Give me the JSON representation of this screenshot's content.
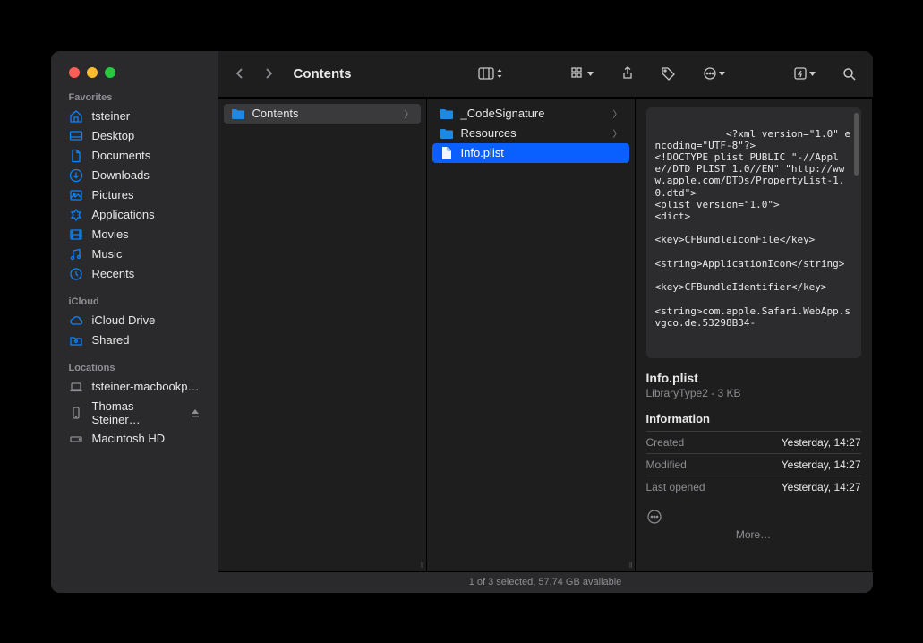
{
  "window": {
    "title": "Contents"
  },
  "sidebar": {
    "sections": [
      {
        "heading": "Favorites",
        "items": [
          {
            "label": "tsteiner",
            "icon": "home"
          },
          {
            "label": "Desktop",
            "icon": "desktop"
          },
          {
            "label": "Documents",
            "icon": "document"
          },
          {
            "label": "Downloads",
            "icon": "download"
          },
          {
            "label": "Pictures",
            "icon": "picture"
          },
          {
            "label": "Applications",
            "icon": "app"
          },
          {
            "label": "Movies",
            "icon": "movie"
          },
          {
            "label": "Music",
            "icon": "music"
          },
          {
            "label": "Recents",
            "icon": "clock"
          }
        ]
      },
      {
        "heading": "iCloud",
        "items": [
          {
            "label": "iCloud Drive",
            "icon": "cloud"
          },
          {
            "label": "Shared",
            "icon": "shared"
          }
        ]
      },
      {
        "heading": "Locations",
        "items": [
          {
            "label": "tsteiner-macbookp…",
            "icon": "laptop"
          },
          {
            "label": "Thomas Steiner…",
            "icon": "phone",
            "eject": true
          },
          {
            "label": "Macintosh HD",
            "icon": "disk"
          }
        ]
      }
    ]
  },
  "columns": {
    "col1": [
      {
        "label": "Contents",
        "icon": "folder",
        "children": true,
        "dim": true
      }
    ],
    "col2": [
      {
        "label": "_CodeSignature",
        "icon": "folder",
        "children": true
      },
      {
        "label": "Resources",
        "icon": "folder",
        "children": true
      },
      {
        "label": "Info.plist",
        "icon": "file",
        "selected": true
      }
    ]
  },
  "preview": {
    "filename": "Info.plist",
    "subtitle": "LibraryType2 - 3 KB",
    "content": "<?xml version=\"1.0\" encoding=\"UTF-8\"?>\n<!DOCTYPE plist PUBLIC \"-//Apple//DTD PLIST 1.0//EN\" \"http://www.apple.com/DTDs/PropertyList-1.0.dtd\">\n<plist version=\"1.0\">\n<dict>\n\n<key>CFBundleIconFile</key>\n\n<string>ApplicationIcon</string>\n\n<key>CFBundleIdentifier</key>\n\n<string>com.apple.Safari.WebApp.svgco.de.53298B34-",
    "info_heading": "Information",
    "info": [
      {
        "key": "Created",
        "value": "Yesterday, 14:27"
      },
      {
        "key": "Modified",
        "value": "Yesterday, 14:27"
      },
      {
        "key": "Last opened",
        "value": "Yesterday, 14:27"
      }
    ],
    "more": "More…"
  },
  "status": "1 of 3 selected, 57,74 GB available"
}
